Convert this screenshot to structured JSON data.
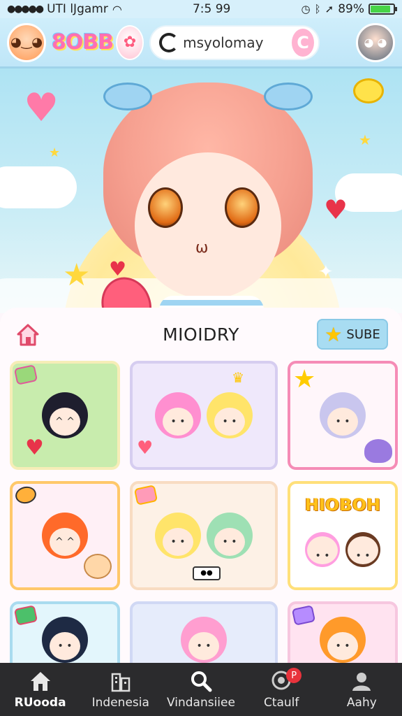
{
  "status_bar": {
    "carrier": "UTI lJgamr",
    "time": "7:5 99",
    "battery_percent": "89%",
    "battery_level": 0.89
  },
  "header": {
    "logo_text": "8OBB",
    "search": {
      "value": "msyolomay",
      "button_label": "C"
    }
  },
  "section": {
    "title": "MIOIDRY",
    "subscribe_label": "SUBE"
  },
  "grid": {
    "featured_card_title": "HIOBOH"
  },
  "bottom_nav": {
    "items": [
      {
        "label": "RUooda",
        "icon": "home-icon"
      },
      {
        "label": "Indenesia",
        "icon": "building-icon"
      },
      {
        "label": "Vindansiiee",
        "icon": "search-icon"
      },
      {
        "label": "Ctaulf",
        "icon": "chat-icon",
        "badge": "P"
      },
      {
        "label": "Aahy",
        "icon": "profile-icon"
      }
    ]
  },
  "colors": {
    "header_bg": "#bfe6f8",
    "accent_pink": "#ff6fb1",
    "nav_bg": "#2b2b2d",
    "subscribe_bg": "#a8dcf2"
  }
}
